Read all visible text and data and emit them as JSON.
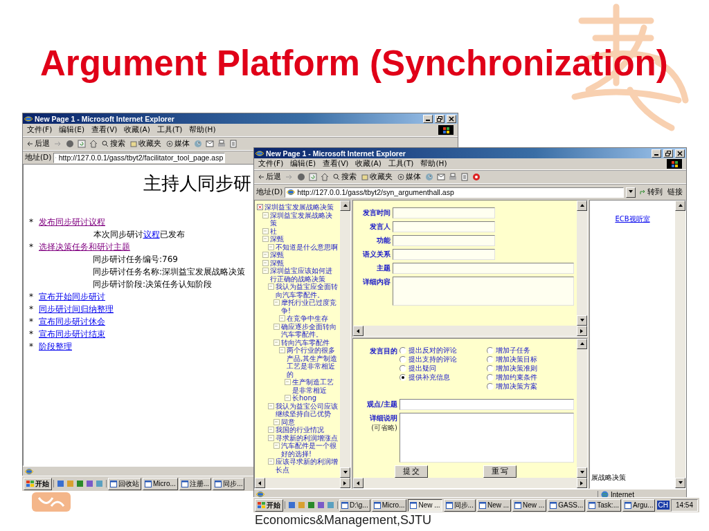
{
  "slide": {
    "title": "Argument Platform (Synchronization)",
    "footer": "Economics&Management,SJTU"
  },
  "back_window": {
    "title": "New Page 1 - Microsoft Internet Explorer",
    "menu": [
      "文件(F)",
      "编辑(E)",
      "查看(V)",
      "收藏(A)",
      "工具(T)",
      "帮助(H)"
    ],
    "toolbar": [
      "后退",
      "搜索",
      "收藏夹",
      "媒体"
    ],
    "address": {
      "label": "地址(D)",
      "url": "http://127.0.0.1/gass/tbyt2/facilitator_tool_page.asp"
    },
    "heading": "主持人同步研",
    "items": [
      {
        "kind": "link",
        "bullet": "*",
        "text": "发布同步研讨议程",
        "visited": true
      },
      {
        "kind": "note",
        "before": "本次同步研讨",
        "link": "议程",
        "after": "已发布"
      },
      {
        "kind": "link",
        "bullet": "*",
        "text": "选择决策任务和研讨主题",
        "visited": true
      },
      {
        "kind": "info",
        "text": "同步研讨任务编号:769"
      },
      {
        "kind": "info",
        "text": "同步研讨任务名称:深圳益宝发展战略决策"
      },
      {
        "kind": "info",
        "text": "同步研讨阶段:决策任务认知阶段"
      },
      {
        "kind": "link",
        "bullet": "*",
        "text": "宣布开始同步研讨",
        "visited": false
      },
      {
        "kind": "link",
        "bullet": "*",
        "text": "同步研讨间归纳整理",
        "visited": false
      },
      {
        "kind": "link",
        "bullet": "*",
        "text": "宣布同步研讨休会",
        "visited": false
      },
      {
        "kind": "link",
        "bullet": "*",
        "text": "宣布同步研讨结束",
        "visited": false
      },
      {
        "kind": "link",
        "bullet": "*",
        "text": "阶段整理",
        "visited": false
      }
    ],
    "taskbar": {
      "start": "开始",
      "items": [
        {
          "label": "回收站",
          "pressed": false
        },
        {
          "label": "Micro...",
          "pressed": false
        },
        {
          "label": "注册...",
          "pressed": false
        },
        {
          "label": "同步...",
          "pressed": false
        }
      ]
    }
  },
  "front_window": {
    "title": "New Page 1 - Microsoft Internet Explorer",
    "menu": [
      "文件(F)",
      "编辑(E)",
      "查看(V)",
      "收藏(A)",
      "工具(T)",
      "帮助(H)"
    ],
    "toolbar": [
      "后退",
      "搜索",
      "收藏夹",
      "媒体"
    ],
    "address": {
      "label": "地址(D)",
      "url": "http://127.0.0.1/gass/tbyt2/syn_argumenthall.asp",
      "go": "转到",
      "links": "链接"
    },
    "tree": {
      "label": "深圳益宝发展战略决策",
      "children": [
        {
          "label": "深圳益宝发展战略决策"
        },
        {
          "label": "社"
        },
        {
          "label": "深甄",
          "children": [
            {
              "label": "不知道是什么意思啊"
            }
          ]
        },
        {
          "label": "深甄"
        },
        {
          "label": "深甄"
        },
        {
          "label": "深圳益宝应该如何进行正确的战略决策",
          "children": [
            {
              "label": "我认为益宝应全面转向汽车零配件。",
              "children": [
                {
                  "label": "摩托行业已过度竞争!",
                  "children": [
                    {
                      "label": "在竞争中生存"
                    }
                  ]
                },
                {
                  "label": "确应逐步全面转向汽车零配件。"
                },
                {
                  "label": "转向汽车零配件",
                  "children": [
                    {
                      "label": "两个行业的很多产品,其生产制造工艺是非常相近的",
                      "children": [
                        {
                          "label": "生产制造工艺是非常相近"
                        },
                        {
                          "label": "长hong"
                        }
                      ]
                    }
                  ]
                }
              ]
            },
            {
              "label": "我认为益宝公司应该继续坚持自己优势",
              "children": [
                {
                  "label": "同意"
                }
              ]
            },
            {
              "label": "我国的行业情况"
            },
            {
              "label": "寻求新的利润增涨点",
              "children": [
                {
                  "label": "汽车配件是一个很好的选择!"
                }
              ]
            },
            {
              "label": "应该寻求新的利润增长点"
            }
          ]
        }
      ]
    },
    "post_fields": [
      {
        "label": "发言时间",
        "kind": "short"
      },
      {
        "label": "发言人",
        "kind": "short"
      },
      {
        "label": "功能",
        "kind": "short"
      },
      {
        "label": "语义关系",
        "kind": "short"
      },
      {
        "label": "主题",
        "kind": "wide"
      },
      {
        "label": "详细内容",
        "kind": "area"
      }
    ],
    "purpose": {
      "label": "发言目的",
      "options_left": [
        {
          "label": "提出反对的评论",
          "selected": false
        },
        {
          "label": "提出支持的评论",
          "selected": false
        },
        {
          "label": "提出疑问",
          "selected": false
        },
        {
          "label": "提供补充信息",
          "selected": true
        }
      ],
      "options_right": [
        {
          "label": "增加子任务",
          "selected": false
        },
        {
          "label": "增加决策目标",
          "selected": false
        },
        {
          "label": "增加决策准则",
          "selected": false
        },
        {
          "label": "增加约束条件",
          "selected": false
        },
        {
          "label": "增加决策方案",
          "selected": false
        }
      ]
    },
    "viewpoint_label": "观点/主题",
    "detail_label": "详细说明",
    "detail_hint": "(可省略)",
    "buttons": [
      "提 交",
      "重 写"
    ],
    "side": {
      "link": "ECB视听室",
      "text": "展战略决策"
    },
    "status": "Internet",
    "taskbar": {
      "start": "开始",
      "items": [
        {
          "label": "D:\\g...",
          "pressed": false
        },
        {
          "label": "Micro...",
          "pressed": false
        },
        {
          "label": "New ...",
          "pressed": true
        },
        {
          "label": "同步...",
          "pressed": false
        },
        {
          "label": "New ...",
          "pressed": false
        },
        {
          "label": "New ...",
          "pressed": false
        },
        {
          "label": "GASS...",
          "pressed": false
        },
        {
          "label": "Task:...",
          "pressed": false
        },
        {
          "label": "Argu...",
          "pressed": false
        }
      ],
      "lang": "CH",
      "clock": "14:54"
    }
  }
}
